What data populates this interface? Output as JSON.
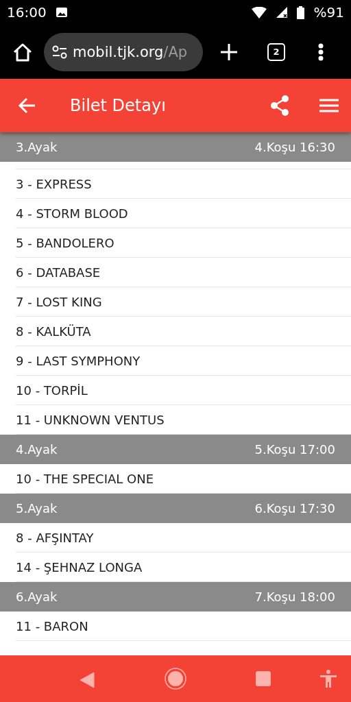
{
  "status_bar": {
    "time": "16:00",
    "battery": "%91"
  },
  "browser": {
    "url_host": "mobil.tjk.org",
    "url_path": "/Ap",
    "tab_count": "2"
  },
  "app_bar": {
    "title": "Bilet Detayı"
  },
  "legs": [
    {
      "leg": "3.Ayak",
      "race": "4.Koşu 16:30",
      "horses": [
        "3 - EXPRESS",
        "4 - STORM BLOOD",
        "5 - BANDOLERO",
        "6 - DATABASE",
        "7 - LOST KING",
        "8 - KALKÜTA",
        "9 - LAST SYMPHONY",
        "10 - TORPİL",
        "11 - UNKNOWN VENTUS"
      ]
    },
    {
      "leg": "4.Ayak",
      "race": "5.Koşu 17:00",
      "horses": [
        "10 - THE SPECIAL ONE"
      ]
    },
    {
      "leg": "5.Ayak",
      "race": "6.Koşu 17:30",
      "horses": [
        "8 - AFŞINTAY",
        "14 - ŞEHNAZ LONGA"
      ]
    },
    {
      "leg": "6.Ayak",
      "race": "7.Koşu 18:00",
      "horses": [
        "11 - BARON"
      ]
    }
  ]
}
